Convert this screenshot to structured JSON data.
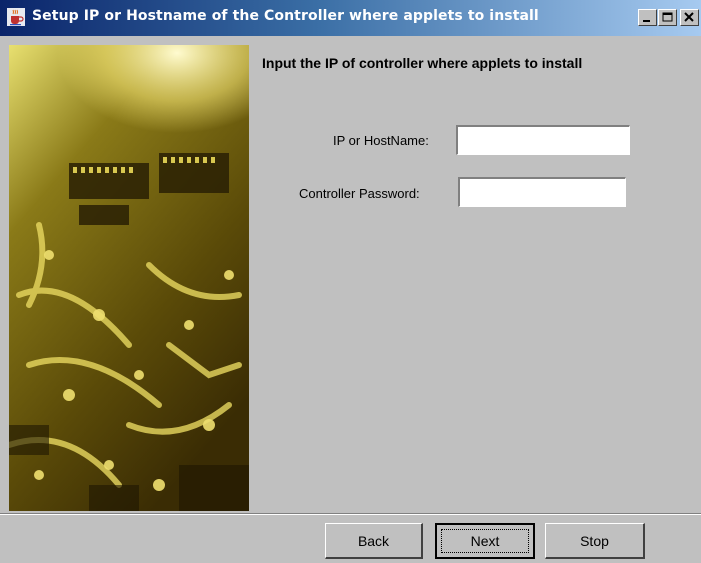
{
  "window": {
    "title": "Setup IP or Hostname of the Controller where applets to install",
    "controls": [
      "minimize-icon",
      "maximize-icon",
      "close-icon"
    ]
  },
  "banner": {
    "image": "circuit-board-image"
  },
  "main": {
    "heading": "Input the IP of controller where applets to install",
    "fields": {
      "ip": {
        "label": "IP or HostName:",
        "value": ""
      },
      "password": {
        "label": "Controller Password:",
        "value": ""
      }
    }
  },
  "footer": {
    "back_label": "Back",
    "next_label": "Next",
    "stop_label": "Stop"
  },
  "colors": {
    "title_start": "#0a246a",
    "title_end": "#a6caf0",
    "window_bg": "#c0c0c0"
  }
}
